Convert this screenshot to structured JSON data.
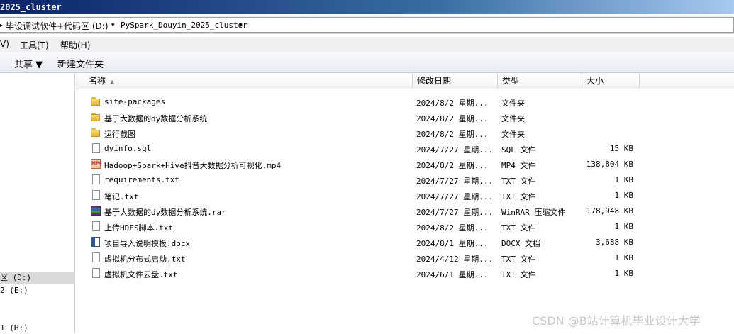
{
  "window": {
    "title": "2025_cluster"
  },
  "address": {
    "segments": [
      "毕设调试软件+代码区 (D:)",
      "PySpark_Douyin_2025_cluster"
    ]
  },
  "menu": [
    "V)",
    "工具(T)",
    "帮助(H)"
  ],
  "toolbar": {
    "share_label": "共享 ▼",
    "new_folder_label": "新建文件夹"
  },
  "navpane": {
    "items": [
      "区 (D:)",
      "2 (E:)",
      "1 (H:)"
    ]
  },
  "columns": {
    "name": "名称",
    "date": "修改日期",
    "type": "类型",
    "size": "大小"
  },
  "files": [
    {
      "icon": "folder",
      "name": "site-packages",
      "date": "2024/8/2 星期...",
      "type": "文件夹",
      "size": ""
    },
    {
      "icon": "folder",
      "name": "基于大数据的dy数据分析系统",
      "date": "2024/8/2 星期...",
      "type": "文件夹",
      "size": ""
    },
    {
      "icon": "folder",
      "name": "运行截图",
      "date": "2024/8/2 星期...",
      "type": "文件夹",
      "size": ""
    },
    {
      "icon": "doc",
      "name": "dyinfo.sql",
      "date": "2024/7/27 星期...",
      "type": "SQL 文件",
      "size": "15 KB"
    },
    {
      "icon": "mp4",
      "name": "Hadoop+Spark+Hive抖音大数据分析可视化.mp4",
      "date": "2024/8/2 星期...",
      "type": "MP4 文件",
      "size": "138,804 KB"
    },
    {
      "icon": "doc",
      "name": "requirements.txt",
      "date": "2024/7/27 星期...",
      "type": "TXT 文件",
      "size": "1 KB"
    },
    {
      "icon": "doc",
      "name": "笔记.txt",
      "date": "2024/7/27 星期...",
      "type": "TXT 文件",
      "size": "1 KB"
    },
    {
      "icon": "rar",
      "name": "基于大数据的dy数据分析系统.rar",
      "date": "2024/7/27 星期...",
      "type": "WinRAR 压缩文件",
      "size": "178,948 KB"
    },
    {
      "icon": "doc",
      "name": "上传HDFS脚本.txt",
      "date": "2024/8/2 星期...",
      "type": "TXT 文件",
      "size": "1 KB"
    },
    {
      "icon": "docx",
      "name": "项目导入说明模板.docx",
      "date": "2024/8/1 星期...",
      "type": "DOCX 文档",
      "size": "3,688 KB"
    },
    {
      "icon": "doc",
      "name": "虚拟机分布式启动.txt",
      "date": "2024/4/12 星期...",
      "type": "TXT 文件",
      "size": "1 KB"
    },
    {
      "icon": "doc",
      "name": "虚拟机文件云盘.txt",
      "date": "2024/6/1 星期...",
      "type": "TXT 文件",
      "size": "1 KB"
    }
  ],
  "watermark": "CSDN @B站计算机毕业设计大学"
}
